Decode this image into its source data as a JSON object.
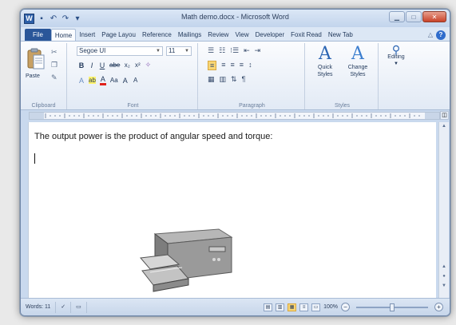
{
  "window": {
    "title": "Math demo.docx - Microsoft Word",
    "app_icon": "W",
    "qat": [
      "save-icon",
      "undo-icon",
      "redo-icon",
      "customize-icon"
    ]
  },
  "tabs": [
    {
      "label": "File",
      "kind": "file"
    },
    {
      "label": "Home",
      "kind": "active"
    },
    {
      "label": "Insert"
    },
    {
      "label": "Page Layou"
    },
    {
      "label": "Reference"
    },
    {
      "label": "Mailings"
    },
    {
      "label": "Review"
    },
    {
      "label": "View"
    },
    {
      "label": "Developer"
    },
    {
      "label": "Foxit Read"
    },
    {
      "label": "New Tab"
    }
  ],
  "ribbon": {
    "clipboard": {
      "label": "Clipboard",
      "paste": "Paste"
    },
    "font": {
      "label": "Font",
      "name": "Segoe UI",
      "size": "11",
      "row2": [
        "B",
        "I",
        "U",
        "abe",
        "x₂",
        "x²"
      ],
      "row3": [
        "A",
        "ab",
        "A",
        "Aa",
        "A",
        "A"
      ]
    },
    "paragraph": {
      "label": "Paragraph",
      "row1": [
        "☰",
        "☷",
        "⁝☰",
        "⇤",
        "⇥"
      ],
      "row2": [
        "≡",
        "≡",
        "≡",
        "≡",
        "↕"
      ],
      "row3": [
        "▦",
        "▥",
        "⇅",
        "¶"
      ]
    },
    "styles": {
      "label": "Styles",
      "quick": "Quick Styles",
      "change": "Change Styles"
    },
    "editing": {
      "label": "Editing"
    }
  },
  "document": {
    "text": "The output power is the product of angular speed and torque:"
  },
  "statusbar": {
    "words": "Words: 11",
    "zoom": "100%",
    "zoom_level": 0.5
  }
}
